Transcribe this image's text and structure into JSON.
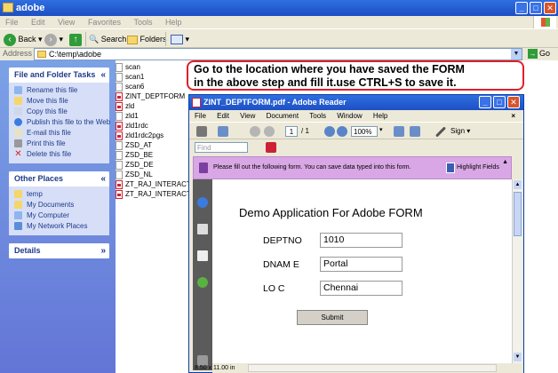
{
  "explorer": {
    "title": "adobe",
    "menu": [
      "File",
      "Edit",
      "View",
      "Favorites",
      "Tools",
      "Help"
    ],
    "toolbar": {
      "back": "Back",
      "search": "Search",
      "folders": "Folders"
    },
    "address_label": "Address",
    "address_value": "C:\\temp\\adobe",
    "go_label": "Go"
  },
  "taskpane": {
    "file_folder_tasks": {
      "title": "File and Folder Tasks",
      "items": [
        "Rename this file",
        "Move this file",
        "Copy this file",
        "Publish this file to the Web",
        "E-mail this file",
        "Print this file",
        "Delete this file"
      ]
    },
    "other_places": {
      "title": "Other Places",
      "items": [
        "temp",
        "My Documents",
        "My Computer",
        "My Network Places"
      ]
    },
    "details": {
      "title": "Details"
    }
  },
  "files": [
    "scan",
    "scan1",
    "scan6",
    "ZINT_DEPTFORM",
    "zld",
    "zld1",
    "zld1rdc",
    "zld1rdc2pgs",
    "ZSD_AT",
    "ZSD_BE",
    "ZSD_DE",
    "ZSD_NL",
    "ZT_RAJ_INTERACTIVE_I",
    "ZT_RAJ_INTERACTIVE_I"
  ],
  "callout": {
    "line1": "Go to the location where you have saved the FORM",
    "line2": "in the above step and fill it.use CTRL+S to save it."
  },
  "reader": {
    "title": "ZINT_DEPTFORM.pdf - Adobe Reader",
    "menu": [
      "File",
      "Edit",
      "View",
      "Document",
      "Tools",
      "Window",
      "Help"
    ],
    "page_current": "1",
    "page_total": "/ 1",
    "zoom": "100%",
    "sign_label": "Sign",
    "find_placeholder": "Find",
    "form_message": "Please fill out the following form. You can save data typed into this form.",
    "highlight_label": "Highlight Fields",
    "page_size": "8.50 x 11.00 in",
    "form": {
      "title": "Demo Application For Adobe FORM",
      "fields": [
        {
          "label": "DEPTNO",
          "value": "1010"
        },
        {
          "label": "DNAM E",
          "value": "Portal"
        },
        {
          "label": "LO C",
          "value": "Chennai"
        }
      ],
      "submit": "Submit"
    }
  }
}
